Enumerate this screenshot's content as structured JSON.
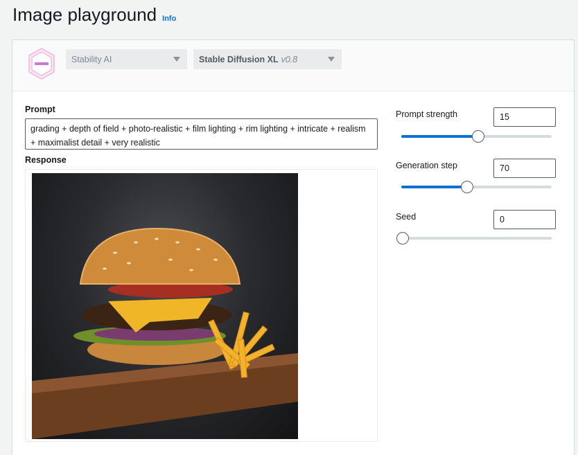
{
  "page": {
    "title": "Image playground",
    "info_link": "Info"
  },
  "model_selector": {
    "logo_icon": "stability-ai-logo-icon",
    "provider": "Stability AI",
    "model_name": "Stable Diffusion XL",
    "model_version": "v0.8"
  },
  "prompt": {
    "label": "Prompt",
    "value": "grading + depth of field + photo-realistic + film lighting + rim lighting + intricate + realism + maximalist detail + very realistic"
  },
  "response": {
    "label": "Response",
    "image_icon": "generated-burger-image"
  },
  "settings": [
    {
      "key": "prompt_strength",
      "label": "Prompt strength",
      "value": "15",
      "slider_fraction": 0.51
    },
    {
      "key": "generation_step",
      "label": "Generation step",
      "value": "70",
      "slider_fraction": 0.44
    },
    {
      "key": "seed",
      "label": "Seed",
      "value": "0",
      "slider_fraction": 0.0
    }
  ],
  "colors": {
    "accent": "#0972d3",
    "background": "#f2f3f3",
    "panel": "#ffffff"
  }
}
